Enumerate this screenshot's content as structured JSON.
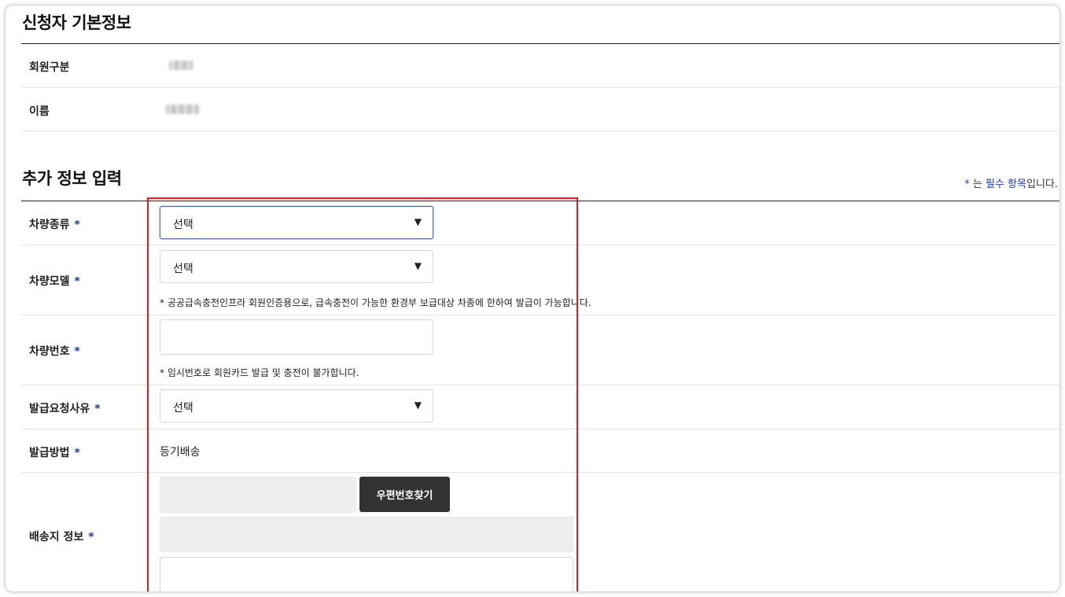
{
  "sections": {
    "basic_title": "신청자 기본정보",
    "extra_title": "추가 정보 입력"
  },
  "basic": {
    "member_type_label": "회원구분",
    "name_label": "이름"
  },
  "required_note": {
    "star": "*",
    "text_before": " 는 ",
    "highlight": "필수 항목",
    "text_after": "입니다."
  },
  "required_star": "*",
  "form": {
    "vehicle_type": {
      "label": "차량종류",
      "value": "선택"
    },
    "vehicle_model": {
      "label": "차량모델",
      "value": "선택",
      "hint": "* 공공급속충전인프라 회원인증용으로, 급속충전이 가능한 환경부 보급대상 차종에 한하여 발급이 가능합니다."
    },
    "vehicle_number": {
      "label": "차량번호",
      "value": "",
      "hint": "* 임시번호로 회원카드 발급 및 충전이 불가합니다."
    },
    "issue_reason": {
      "label": "발급요청사유",
      "value": "선택"
    },
    "issue_method": {
      "label": "발급방법",
      "value": "등기배송"
    },
    "delivery": {
      "label": "배송지 정보",
      "postcode": "",
      "address": "",
      "detail_address": "",
      "find_postcode_button": "우편번호찾기"
    }
  },
  "colors": {
    "accent_required": "#1a3ab0",
    "highlight_box": "#e01b1b",
    "dark_button": "#333333"
  }
}
